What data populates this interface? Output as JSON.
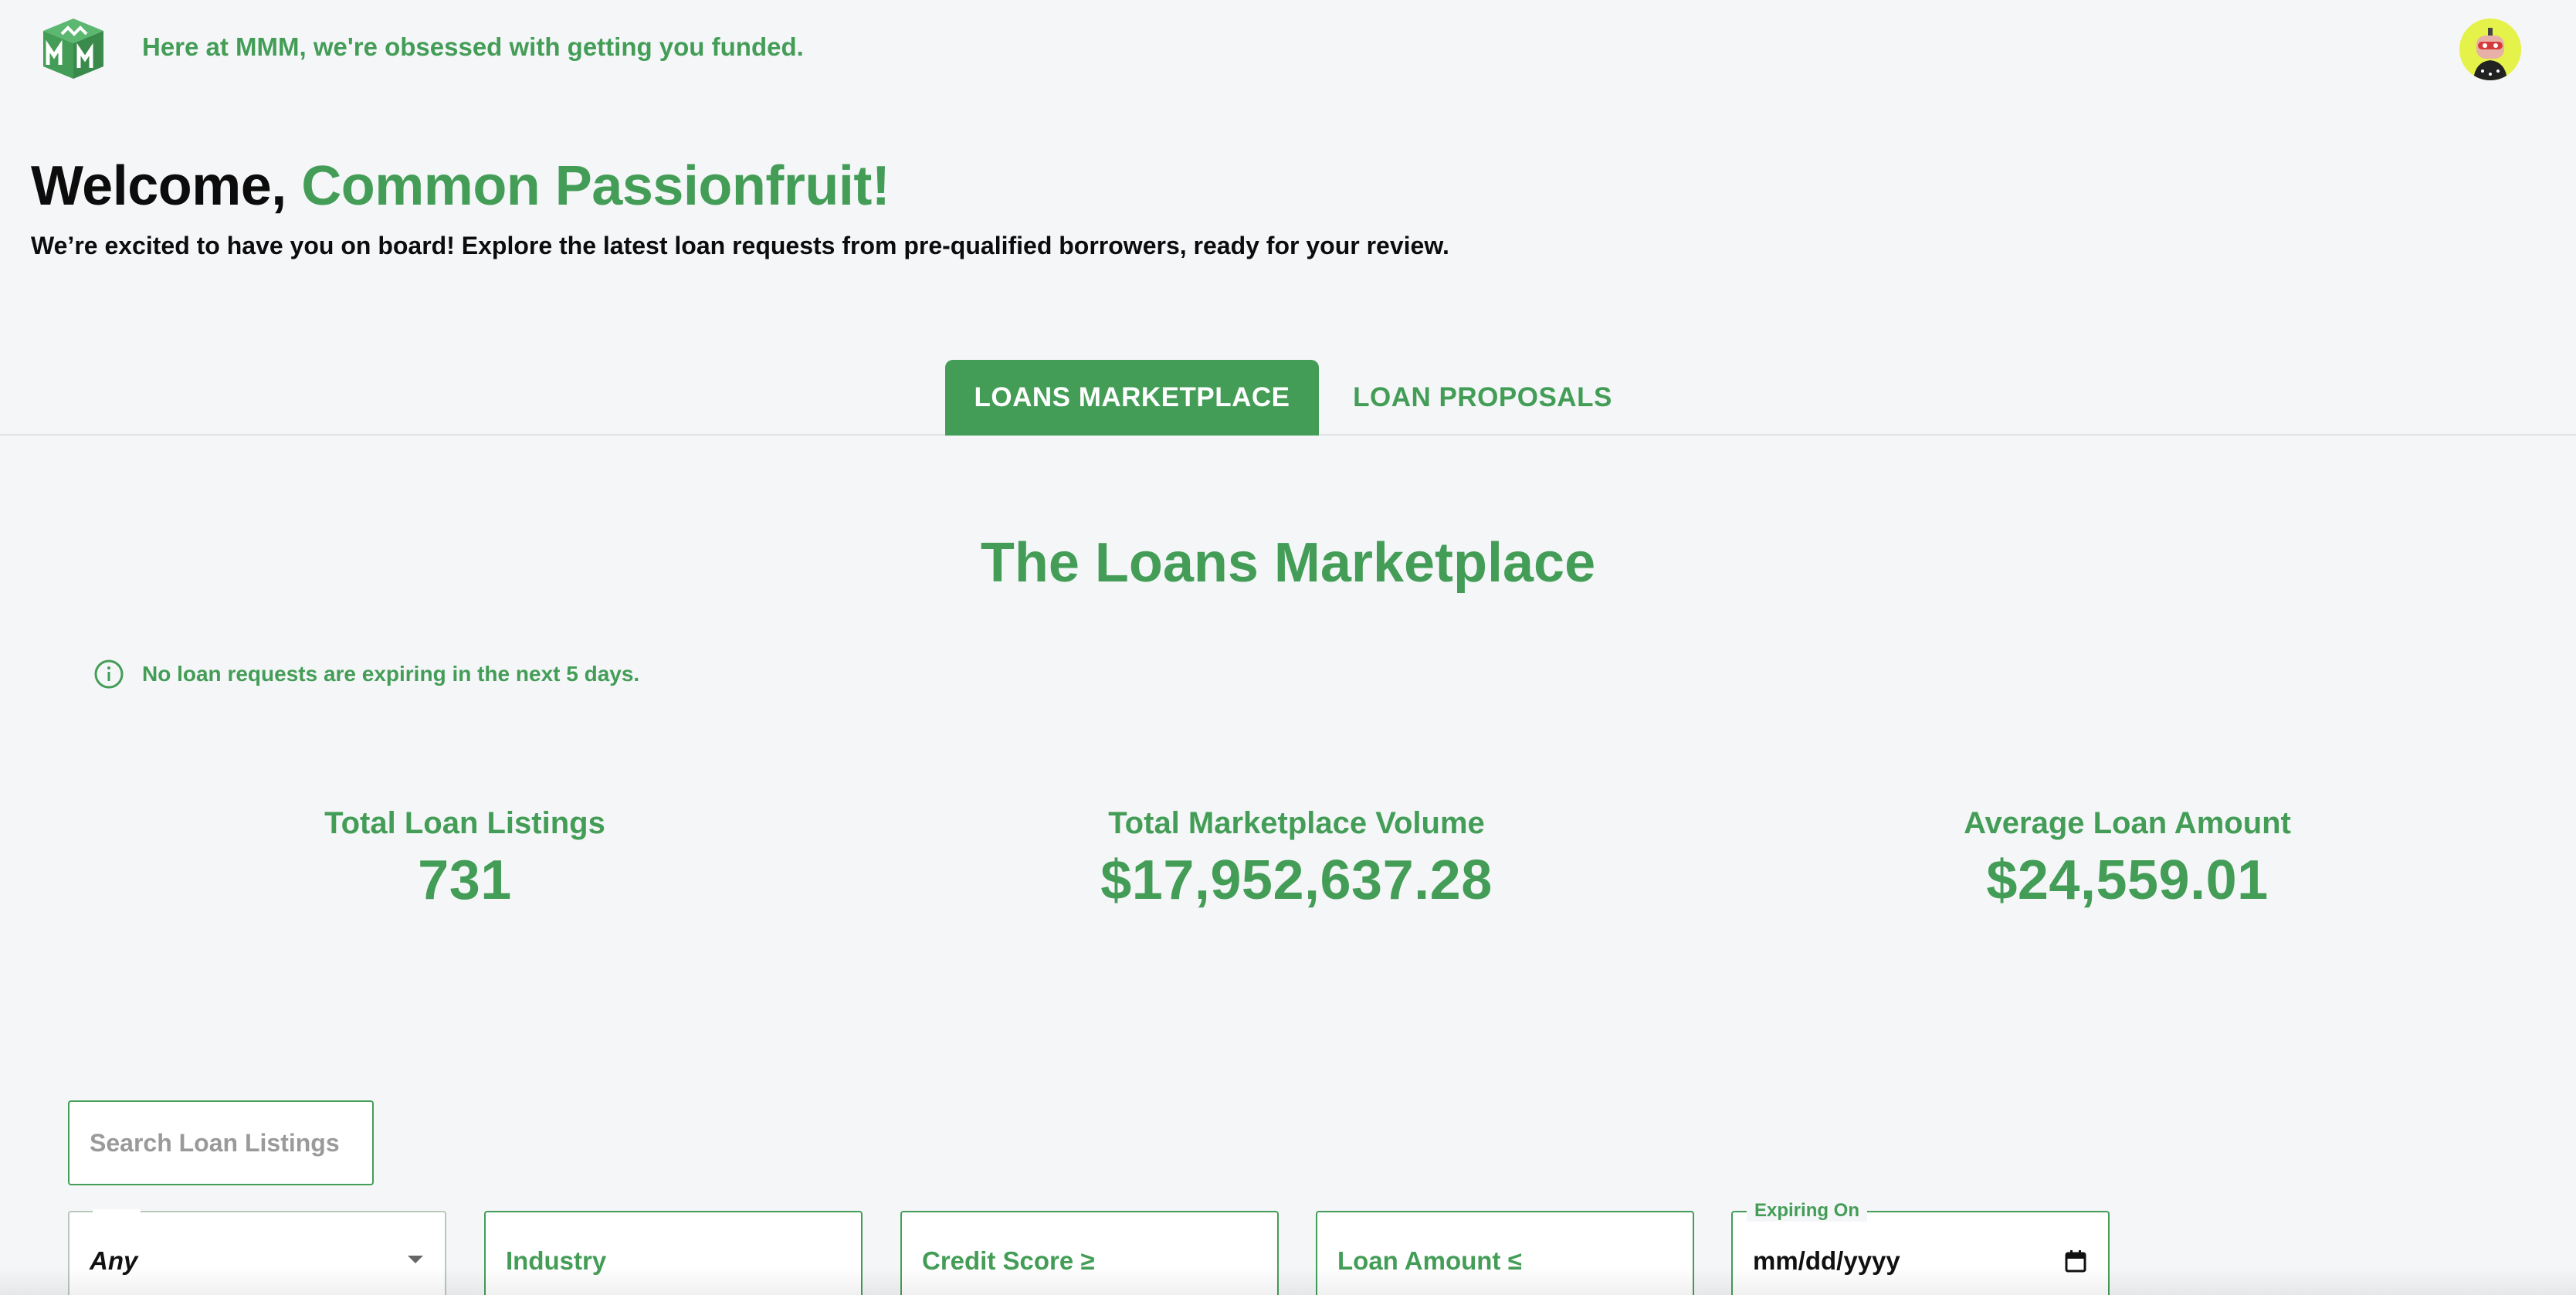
{
  "header": {
    "tagline": "Here at MMM, we're obsessed with getting you funded.",
    "logo_icon": "mmm-cube-logo",
    "avatar_icon": "robot-avatar"
  },
  "welcome": {
    "prefix": "Welcome, ",
    "name": "Common Passionfruit!",
    "subtitle": "We’re excited to have you on board! Explore the latest loan requests from pre-qualified borrowers, ready for your review."
  },
  "tabs": [
    {
      "label": "LOANS MARKETPLACE",
      "active": true
    },
    {
      "label": "LOAN PROPOSALS",
      "active": false
    }
  ],
  "marketplace": {
    "title": "The Loans Marketplace",
    "notice": "No loan requests are expiring in the next 5 days.",
    "notice_icon": "info-circle-icon"
  },
  "stats": [
    {
      "label": "Total Loan Listings",
      "value": "731"
    },
    {
      "label": "Total Marketplace Volume",
      "value": "$17,952,637.28"
    },
    {
      "label": "Average Loan Amount",
      "value": "$24,559.01"
    }
  ],
  "search": {
    "placeholder": "Search Loan Listings"
  },
  "filters": {
    "status_selected": "Any",
    "industry": "Industry",
    "credit_score": "Credit Score ≥",
    "loan_amount": "Loan Amount ≤",
    "expiring_label": "Expiring On",
    "expiring_placeholder": "mm/dd/yyyy"
  },
  "colors": {
    "accent": "#449d57",
    "background": "#f4f6f8",
    "avatar_bg": "#e5f24a"
  }
}
